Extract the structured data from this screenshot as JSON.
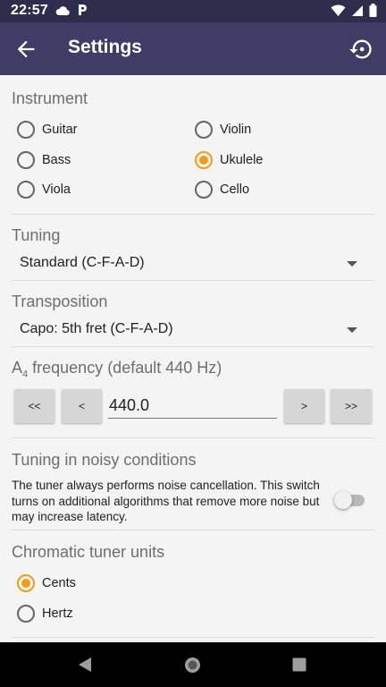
{
  "status_bar": {
    "time": "22:57",
    "left_icons": [
      "cloud-icon",
      "parking-icon"
    ],
    "right_icons": [
      "wifi-icon",
      "signal-icon",
      "battery-icon"
    ]
  },
  "app_bar": {
    "title": "Settings",
    "back_icon": "arrow-back-icon",
    "reset_icon": "restore-icon"
  },
  "instrument": {
    "title": "Instrument",
    "options": [
      {
        "label": "Guitar",
        "checked": false
      },
      {
        "label": "Violin",
        "checked": false
      },
      {
        "label": "Bass",
        "checked": false
      },
      {
        "label": "Ukulele",
        "checked": true
      },
      {
        "label": "Viola",
        "checked": false
      },
      {
        "label": "Cello",
        "checked": false
      }
    ]
  },
  "tuning": {
    "title": "Tuning",
    "selected": "Standard (C-F-A-D)"
  },
  "transposition": {
    "title": "Transposition",
    "selected": "Capo: 5th fret (C-F-A-D)"
  },
  "frequency": {
    "title_prefix": "A",
    "title_subscript": "4",
    "title_suffix": " frequency (default 440 Hz)",
    "value": "440.0",
    "buttons": {
      "dec_large": "<<",
      "dec_small": "<",
      "inc_small": ">",
      "inc_large": ">>"
    }
  },
  "noise": {
    "title": "Tuning in noisy conditions",
    "description": "The tuner always performs noise cancellation. This switch turns on additional algorithms that remove more noise but may increase latency.",
    "enabled": false
  },
  "chromatic_units": {
    "title": "Chromatic tuner units",
    "options": [
      {
        "label": "Cents",
        "checked": true
      },
      {
        "label": "Hertz",
        "checked": false
      }
    ]
  },
  "colors": {
    "status_bar": "#2f2d4b",
    "app_bar": "#3f3c66",
    "accent": "#f29a1a",
    "background": "#f4f4f4"
  }
}
